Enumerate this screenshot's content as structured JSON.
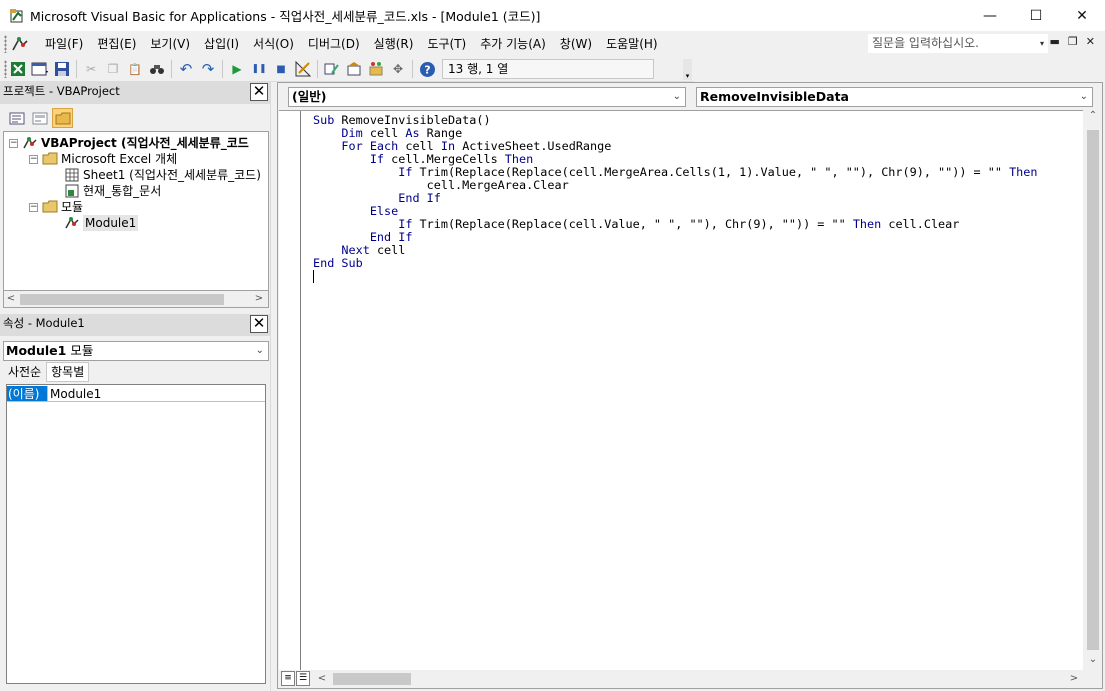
{
  "window": {
    "title": "Microsoft Visual Basic for Applications - 직업사전_세세분류_코드.xls - [Module1 (코드)]",
    "minimize": "—",
    "maximize": "☐",
    "close": "✕"
  },
  "menu": {
    "items": [
      "파일(F)",
      "편집(E)",
      "보기(V)",
      "삽입(I)",
      "서식(O)",
      "디버그(D)",
      "실행(R)",
      "도구(T)",
      "추가 기능(A)",
      "창(W)",
      "도움말(H)"
    ],
    "help_placeholder": "질문을 입력하십시오.",
    "help_dropdown": "▾",
    "mdi_minimize": "▬",
    "mdi_restore": "❐",
    "mdi_close": "✕"
  },
  "toolbar": {
    "position": "13 행, 1 열",
    "buttons": {
      "excel": "X",
      "insert": "▦",
      "save": "▪",
      "cut": "✂",
      "copy": "❐",
      "paste": "📋",
      "find": "🔍",
      "undo": "↶",
      "redo": "↷",
      "run": "▶",
      "break": "❚❚",
      "reset": "■",
      "design": "📐",
      "project_explorer": "🗂",
      "properties": "📝",
      "object_browser": "🧰",
      "toolbox": "✥",
      "help": "?"
    },
    "end_marker": "▾"
  },
  "project_pane": {
    "title": "프로젝트 - VBAProject",
    "close": "✕",
    "tree": {
      "project": "VBAProject (직업사전_세세분류_코드",
      "excel_objects": "Microsoft Excel 개체",
      "sheet1": "Sheet1 (직업사전_세세분류_코드)",
      "workbook": "현재_통합_문서",
      "modules": "모듈",
      "module1": "Module1"
    },
    "expander_minus": "−",
    "scroll_left": "<",
    "scroll_right": ">"
  },
  "properties_pane": {
    "title": "속성 - Module1",
    "close": "✕",
    "object_name": "Module1",
    "object_type": "모듈",
    "dropdown": "⌄",
    "tabs": [
      "사전순",
      "항목별"
    ],
    "row_key": "(이름)",
    "row_value": "Module1"
  },
  "code_window": {
    "object_combo": "(일반)",
    "proc_combo": "RemoveInvisibleData",
    "dropdown": "⌄",
    "scroll_up": "⌃",
    "scroll_down": "⌄",
    "scroll_left": "<",
    "scroll_right": ">",
    "view_proc": "≡",
    "view_full": "☰",
    "lines": [
      [
        [
          "kw",
          "Sub"
        ],
        [
          "t",
          " RemoveInvisibleData()"
        ]
      ],
      [
        [
          "t",
          "    "
        ],
        [
          "kw",
          "Dim"
        ],
        [
          "t",
          " cell "
        ],
        [
          "kw",
          "As"
        ],
        [
          "t",
          " Range"
        ]
      ],
      [
        [
          "t",
          "    "
        ],
        [
          "kw",
          "For Each"
        ],
        [
          "t",
          " cell "
        ],
        [
          "kw",
          "In"
        ],
        [
          "t",
          " ActiveSheet.UsedRange"
        ]
      ],
      [
        [
          "t",
          "        "
        ],
        [
          "kw",
          "If"
        ],
        [
          "t",
          " cell.MergeCells "
        ],
        [
          "kw",
          "Then"
        ]
      ],
      [
        [
          "t",
          "            "
        ],
        [
          "kw",
          "If"
        ],
        [
          "t",
          " Trim(Replace(Replace(cell.MergeArea.Cells(1, 1).Value, \" \", \"\"), Chr(9), \"\")) = \"\" "
        ],
        [
          "kw",
          "Then"
        ]
      ],
      [
        [
          "t",
          "                cell.MergeArea.Clear"
        ]
      ],
      [
        [
          "t",
          "            "
        ],
        [
          "kw",
          "End If"
        ]
      ],
      [
        [
          "t",
          "        "
        ],
        [
          "kw",
          "Else"
        ]
      ],
      [
        [
          "t",
          "            "
        ],
        [
          "kw",
          "If"
        ],
        [
          "t",
          " Trim(Replace(Replace(cell.Value, \" \", \"\"), Chr(9), \"\")) = \"\" "
        ],
        [
          "kw",
          "Then"
        ],
        [
          "t",
          " cell.Clear"
        ]
      ],
      [
        [
          "t",
          "        "
        ],
        [
          "kw",
          "End If"
        ]
      ],
      [
        [
          "t",
          "    "
        ],
        [
          "kw",
          "Next"
        ],
        [
          "t",
          " cell"
        ]
      ],
      [
        [
          "kw",
          "End Sub"
        ]
      ],
      [
        [
          "cursor",
          ""
        ]
      ]
    ]
  }
}
